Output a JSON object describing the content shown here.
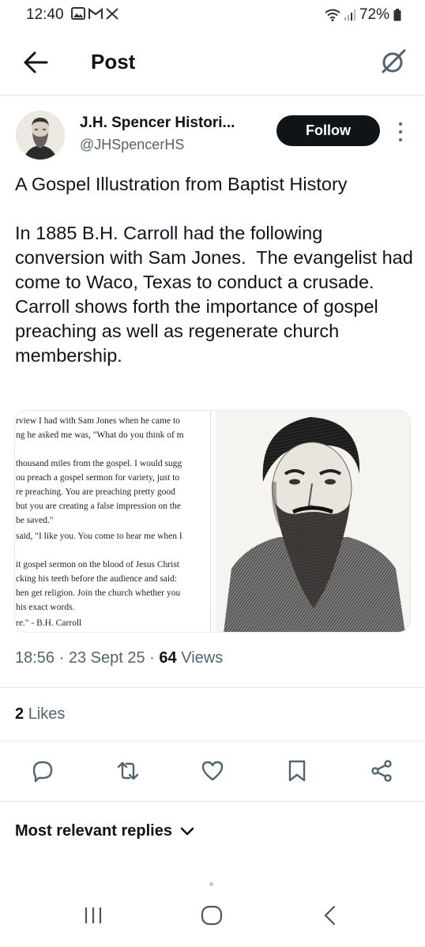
{
  "status": {
    "time": "12:40",
    "battery": "72%",
    "notification_icons": [
      "gallery-icon",
      "gmail-icon",
      "x-icon"
    ]
  },
  "header": {
    "title": "Post"
  },
  "author": {
    "name": "J.H. Spencer Histori...",
    "handle": "@JHSpencerHS",
    "follow_label": "Follow"
  },
  "tweet": {
    "text": "A Gospel Illustration from Baptist History\n\nIn 1885 B.H. Carroll had the following conversion with Sam Jones.  The evangelist had come to Waco, Texas to conduct a crusade.  Carroll shows forth the importance of gospel preaching as well as regenerate church membership."
  },
  "media": {
    "lines": [
      "rview I had with Sam Jones when he came to",
      "ng he asked me was, \"What do you think of m",
      "thousand miles from the gospel. I would sugg",
      "ou preach a gospel sermon for variety, just to",
      "re preaching. You are preaching pretty good",
      "but you are creating a false impression on the",
      "be saved.\"",
      " said, \"I like you. You come to hear me when I",
      "it gospel sermon on the blood of Jesus Christ",
      "cking his teeth before the audience and said:",
      "hen get religion. Join the church whether you",
      "his exact words.",
      "re.\"  - B.H. Carroll"
    ]
  },
  "meta": {
    "time": "18:56",
    "date": "23 Sept 25",
    "views_count": "64",
    "views_label": "Views"
  },
  "likes": {
    "count": "2",
    "label": "Likes"
  },
  "replies": {
    "label": "Most relevant replies"
  },
  "colors": {
    "text": "#0f1419",
    "secondary": "#536471",
    "divider": "#e6e9eb"
  }
}
